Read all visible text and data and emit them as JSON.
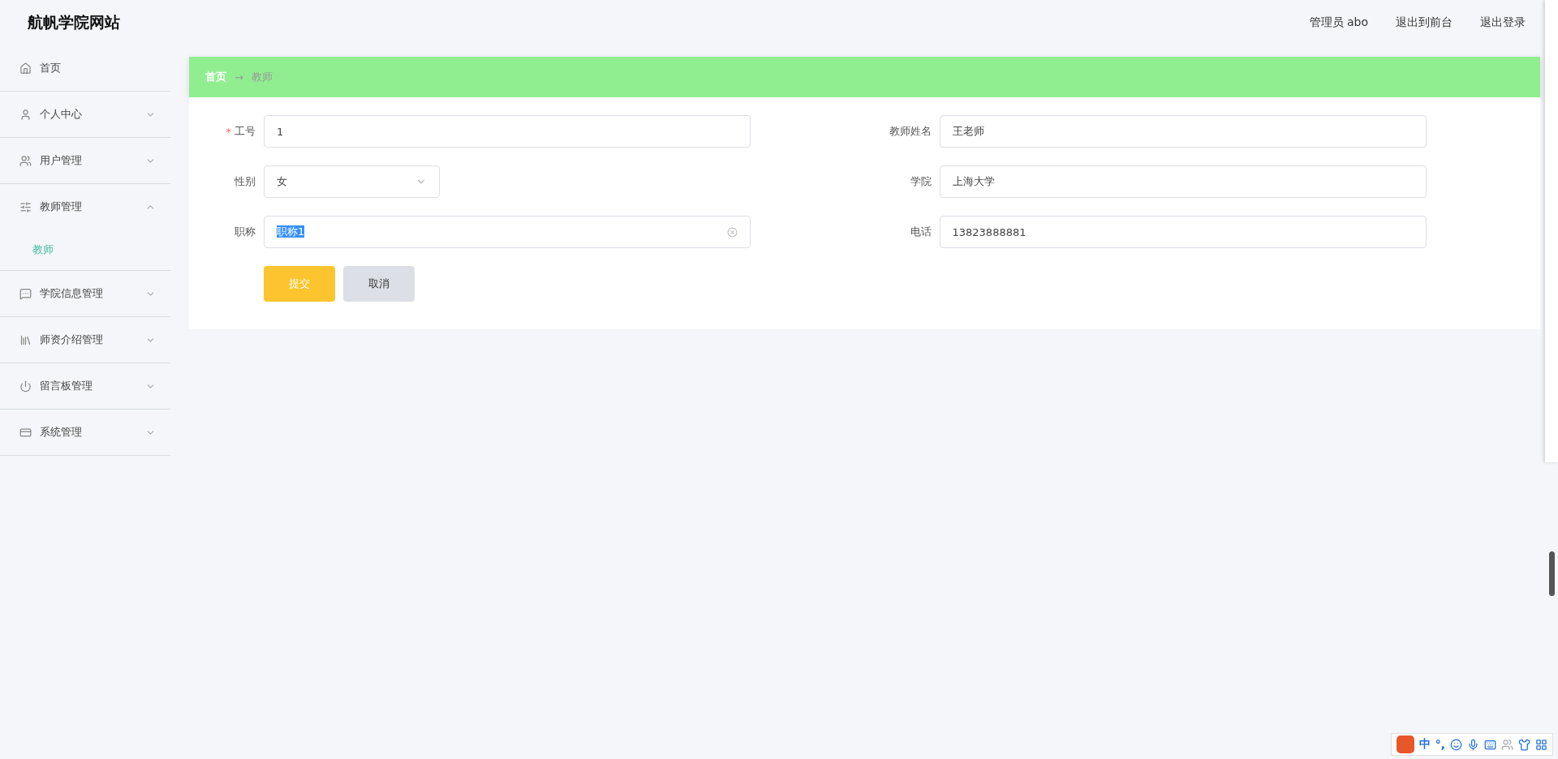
{
  "site_title": "航帆学院网站",
  "header_links": [
    "管理员 abo",
    "退出到前台",
    "退出登录"
  ],
  "sidebar": {
    "items": [
      {
        "label": "首页",
        "kind": "link"
      },
      {
        "label": "个人中心",
        "kind": "group",
        "expanded": false
      },
      {
        "label": "用户管理",
        "kind": "group",
        "expanded": false
      },
      {
        "label": "教师管理",
        "kind": "group",
        "expanded": true,
        "children": [
          {
            "label": "教师",
            "selected": true
          }
        ]
      },
      {
        "label": "学院信息管理",
        "kind": "group",
        "expanded": false
      },
      {
        "label": "师资介绍管理",
        "kind": "group",
        "expanded": false
      },
      {
        "label": "留言板管理",
        "kind": "group",
        "expanded": false
      },
      {
        "label": "系统管理",
        "kind": "group",
        "expanded": false
      }
    ]
  },
  "breadcrumb": [
    "首页",
    "→",
    "教师"
  ],
  "form": {
    "rows": [
      [
        {
          "label": "工号",
          "required_mark": "*",
          "kind": "input",
          "value": "1"
        },
        {
          "label": "教师姓名",
          "kind": "input",
          "value": "王老师"
        }
      ],
      [
        {
          "label": "性别",
          "kind": "select",
          "value": "女"
        },
        {
          "label": "学院",
          "kind": "input",
          "value": "上海大学"
        }
      ],
      [
        {
          "label": "职称",
          "kind": "input",
          "value": "职称1",
          "highlighted": true,
          "clearable": true
        },
        {
          "label": "电话",
          "kind": "input",
          "value": "13823888881"
        }
      ]
    ],
    "buttons": [
      {
        "label": "提交",
        "kind": "primary"
      },
      {
        "label": "取消",
        "kind": "secondary"
      }
    ]
  },
  "ime_bar": {
    "mode": "中",
    "punct": "°,"
  }
}
